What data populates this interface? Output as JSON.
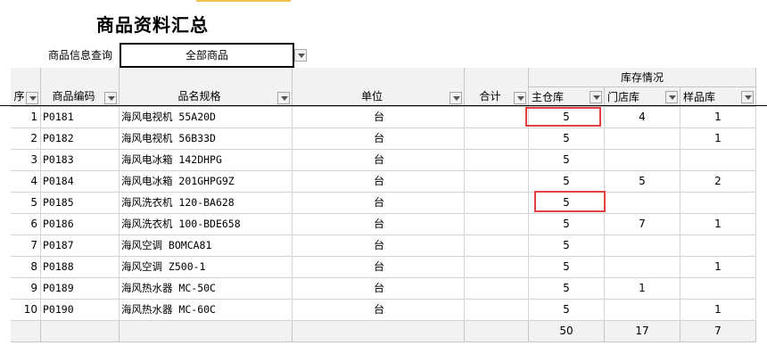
{
  "title": "商品资料汇总",
  "query": {
    "label": "商品信息查询",
    "value": "全部商品"
  },
  "headers": {
    "seq": "序",
    "code": "商品编码",
    "name": "品名规格",
    "unit": "单位",
    "total": "合计",
    "stock_group": "库存情况",
    "main": "主仓库",
    "store": "门店库",
    "sample": "样品库"
  },
  "rows": [
    {
      "seq": "1",
      "code": "P0181",
      "name": "海风电视机 55A20D",
      "unit": "台",
      "total": "",
      "main": "5",
      "store": "4",
      "sample": "1"
    },
    {
      "seq": "2",
      "code": "P0182",
      "name": "海风电视机 56B33D",
      "unit": "台",
      "total": "",
      "main": "5",
      "store": "",
      "sample": "1"
    },
    {
      "seq": "3",
      "code": "P0183",
      "name": "海风电冰箱 142DHPG",
      "unit": "台",
      "total": "",
      "main": "5",
      "store": "",
      "sample": ""
    },
    {
      "seq": "4",
      "code": "P0184",
      "name": "海风电冰箱 201GHPG9Z",
      "unit": "台",
      "total": "",
      "main": "5",
      "store": "5",
      "sample": "2"
    },
    {
      "seq": "5",
      "code": "P0185",
      "name": "海风洗衣机 120-BA628",
      "unit": "台",
      "total": "",
      "main": "5",
      "store": "",
      "sample": ""
    },
    {
      "seq": "6",
      "code": "P0186",
      "name": "海风洗衣机 100-BDE658",
      "unit": "台",
      "total": "",
      "main": "5",
      "store": "7",
      "sample": "1"
    },
    {
      "seq": "7",
      "code": "P0187",
      "name": "海风空调 BOMCA81",
      "unit": "台",
      "total": "",
      "main": "5",
      "store": "",
      "sample": ""
    },
    {
      "seq": "8",
      "code": "P0188",
      "name": "海风空调 Z500-1",
      "unit": "台",
      "total": "",
      "main": "5",
      "store": "",
      "sample": "1"
    },
    {
      "seq": "9",
      "code": "P0189",
      "name": "海风热水器 MC-50C",
      "unit": "台",
      "total": "",
      "main": "5",
      "store": "1",
      "sample": ""
    },
    {
      "seq": "10",
      "code": "P0190",
      "name": "海风热水器 MC-60C",
      "unit": "台",
      "total": "",
      "main": "5",
      "store": "",
      "sample": "1"
    }
  ],
  "totals": {
    "main": "50",
    "store": "17",
    "sample": "7"
  },
  "colors": {
    "highlight": "#e0403f",
    "header_bg": "#f2f2f2",
    "title_accent": "#f2c14b"
  }
}
